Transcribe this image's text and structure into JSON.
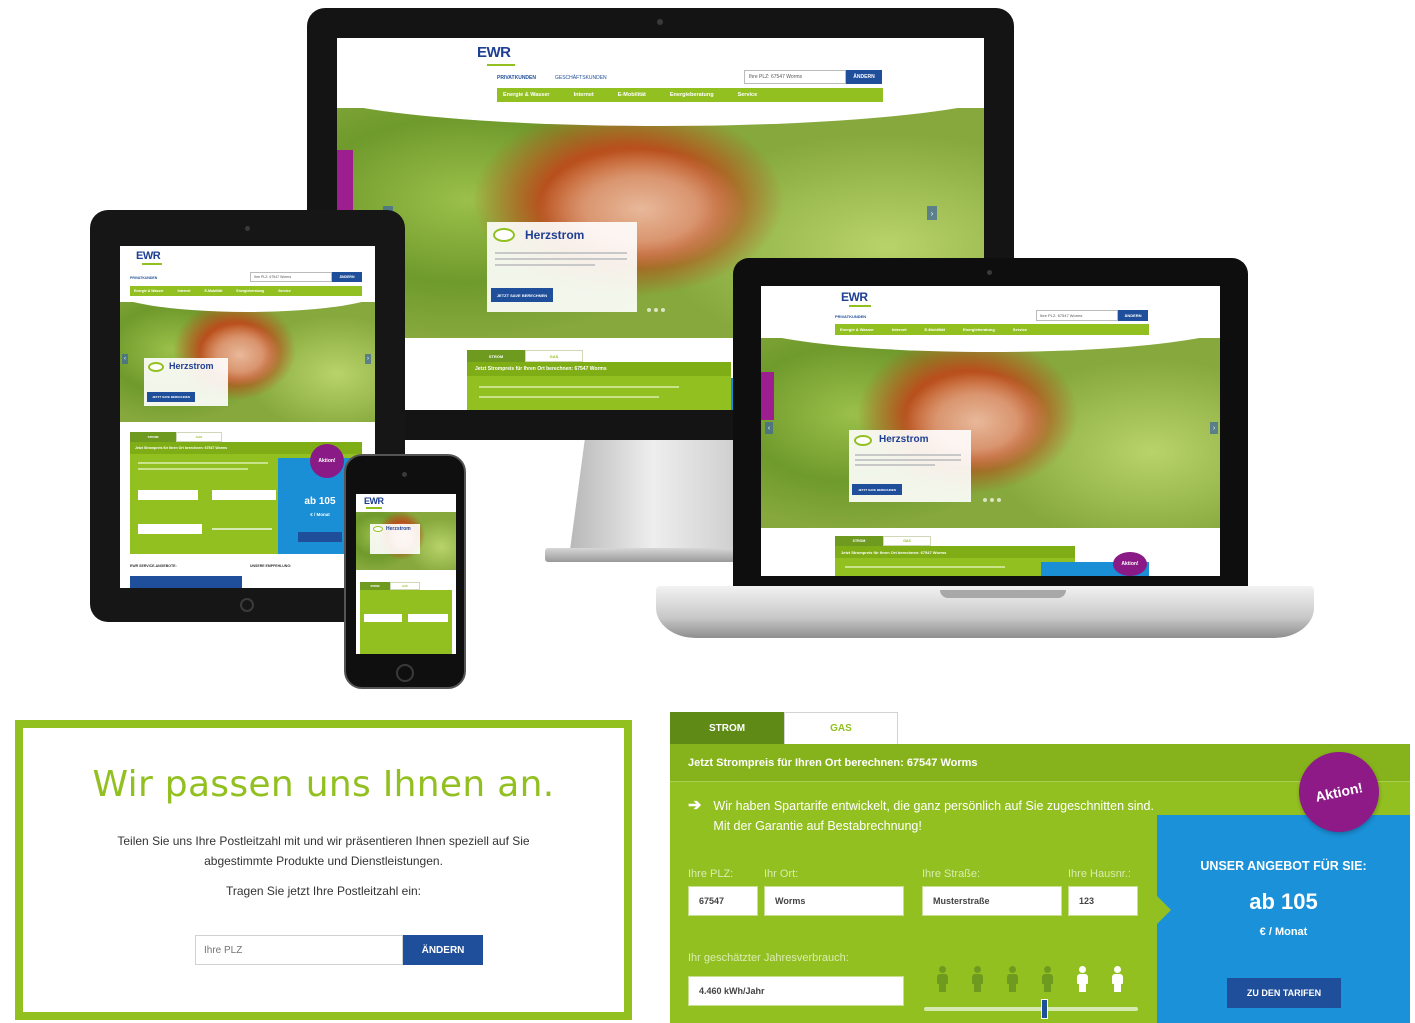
{
  "site": {
    "logo": "EWR",
    "promo_title": "Herzstrom",
    "promo_text": "Lorem ipsum dolor sit amet, consetetur sadipscing elitr, sed diam nonumy eirmod tempor invidunt ut labore et dolore magna aliquyam erat, sed diam voluptua.",
    "promo_button": "JETZT SAVE BERECHNEN",
    "search_value": "Ihre PLZ: 67547 Worms",
    "search_button": "ÄNDERN",
    "side_tab": "KUNDENSERVICE",
    "nav": [
      "Energie & Wasser",
      "Internet",
      "E-Mobilität",
      "Energieberatung",
      "Service"
    ],
    "subnav": [
      "PRIVATKUNDEN",
      "GESCHÄFTSKUNDEN"
    ],
    "tab_labels": [
      "STROM",
      "GAS"
    ],
    "calc_header": "Jetzt Strompreis für Ihren Ort berechnen: 67547 Worms",
    "calc_intro": "Wir haben Spartarife entwickelt, die ganz persönlich auf Sie zugeschnitten sind. Mit der Garantie auf Bestabrechnung!",
    "badge": "Aktion!",
    "offer_price": "ab 105",
    "offer_unit": "€ / Monat",
    "phone_section_left": "EWR SERVICE-ANGEBOTE:",
    "phone_section_right": "UNSERE EMPFEHLUNG:"
  },
  "plz_card": {
    "title": "Wir passen uns Ihnen an.",
    "text": "Teilen Sie uns Ihre Postleitzahl mit und wir präsentieren Ihnen speziell auf Sie abgestimmte Produkte und Dienstleistungen.",
    "prompt": "Tragen Sie jetzt Ihre Postleitzahl ein:",
    "input_placeholder": "Ihre PLZ",
    "button": "ÄNDERN"
  },
  "calculator": {
    "tab_strom": "STROM",
    "tab_gas": "GAS",
    "header": "Jetzt Strompreis für Ihren Ort berechnen: 67547 Worms",
    "intro": "Wir haben Spartarife entwickelt, die ganz persönlich auf Sie zugeschnitten sind. Mit der Garantie auf Bestabrechnung!",
    "labels": {
      "plz": "Ihre PLZ:",
      "ort": "Ihr Ort:",
      "strasse": "Ihre Straße:",
      "hausnr": "Ihre Hausnr.:",
      "verbrauch": "Ihr geschätzter Jahresverbrauch:"
    },
    "values": {
      "plz": "67547",
      "ort": "Worms",
      "strasse": "Musterstraße",
      "hausnr": "123",
      "verbrauch": "4.460 kWh/Jahr"
    },
    "household_persons_total": 6,
    "household_persons_selected": 4,
    "slider_fraction": 0.56,
    "offer_title": "UNSER ANGEBOT FÜR SIE:",
    "offer_price": "ab 105",
    "offer_unit": "€ / Monat",
    "offer_button": "ZU DEN TARIFEN",
    "badge": "Aktion!"
  },
  "colors": {
    "brand_green": "#93c021",
    "brand_blue": "#1f4e9a",
    "offer_blue": "#1a91d8",
    "badge_purple": "#8e1a87"
  }
}
